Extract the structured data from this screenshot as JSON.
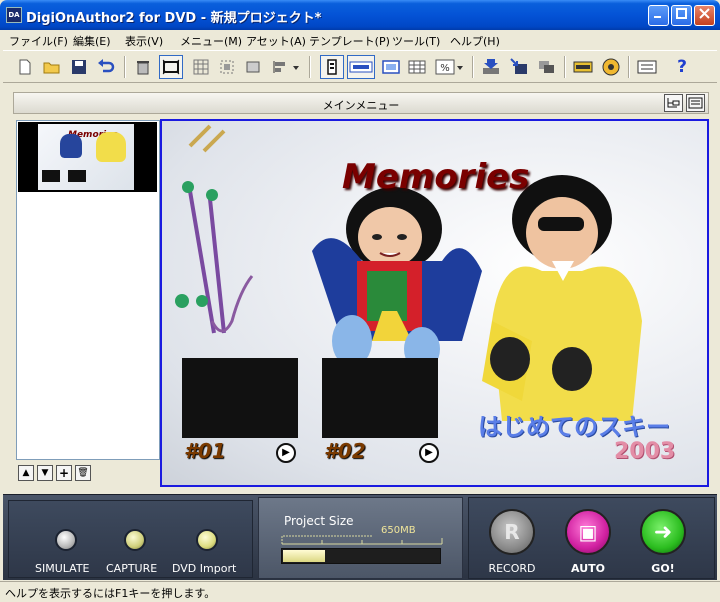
{
  "window": {
    "title": "DigiOnAuthor2 for DVD - 新規プロジェクト*",
    "icon_text": "DA"
  },
  "menu": [
    "ファイル(F)",
    "編集(E)",
    "表示(V)",
    "メニュー(M)",
    "アセット(A)",
    "テンプレート(P)",
    "ツール(T)",
    "ヘルプ(H)"
  ],
  "toolbar": {
    "icons": [
      "new-file-icon",
      "open-folder-icon",
      "save-icon",
      "undo-icon",
      "trash-icon",
      "fit-icon",
      "grid-icon",
      "select-icon",
      "frame-icon",
      "align-icon",
      "chapter-icon",
      "button-row-icon",
      "screen-icon",
      "table-icon",
      "percent-icon",
      "import-icon",
      "export-icon",
      "layer-icon",
      "dvd-icon",
      "disc-icon",
      "list-icon",
      "help-icon"
    ],
    "help_glyph": "?",
    "percent_glyph": "%"
  },
  "panel": {
    "title": "メインメニュー"
  },
  "thumb": {
    "title": "Memories"
  },
  "nav_buttons": [
    "▲",
    "▼",
    "+",
    "🗑"
  ],
  "canvas": {
    "title": "Memories",
    "buttons": [
      {
        "label": "#01"
      },
      {
        "label": "#02"
      }
    ],
    "caption": "はじめてのスキー",
    "year": "2003",
    "play_glyph": "▶"
  },
  "controls": {
    "left_buttons": [
      {
        "label": "SIMULATE",
        "led_color": "#d8d8d8"
      },
      {
        "label": "CAPTURE",
        "led_color": "#d9d98a"
      },
      {
        "label": "DVD Import",
        "led_color": "#e4e48a"
      }
    ],
    "project_size_label": "Project Size",
    "capacity_label": "650MB",
    "progress_fraction": 0.27,
    "right_buttons": [
      {
        "label": "RECORD",
        "color": "#8a8a8a",
        "glyph": "R"
      },
      {
        "label": "AUTO",
        "color": "#d020a0",
        "glyph": "▣"
      },
      {
        "label": "GO!",
        "color": "#2bbd1f",
        "glyph": "➜"
      }
    ]
  },
  "status": {
    "text": "ヘルプを表示するにはF1キーを押します。"
  },
  "colors": {
    "title_bar": "#0453d6",
    "canvas_border": "#1a1ae0",
    "memories": "#7a0000",
    "caption": "#5a7ee8",
    "year": "#e38da6",
    "button_label": "#7a3a00"
  }
}
